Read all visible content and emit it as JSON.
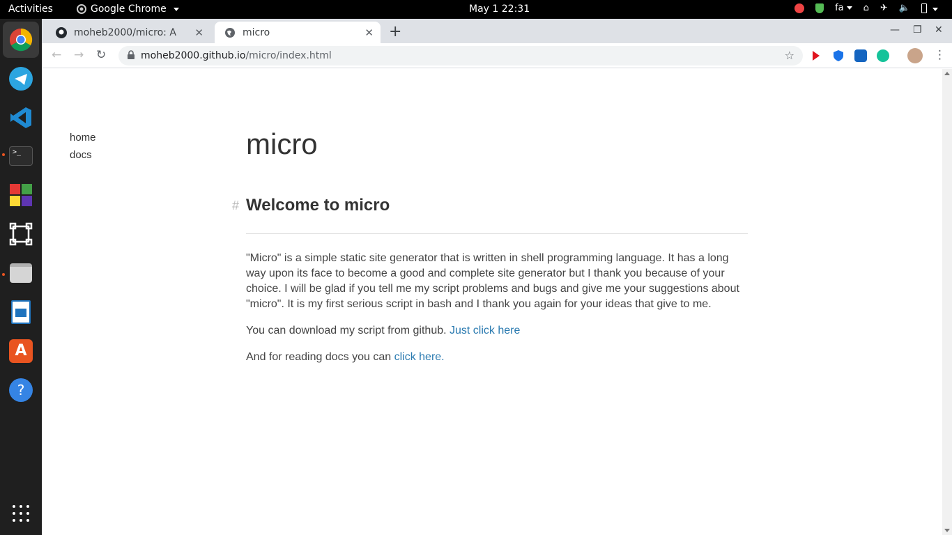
{
  "topbar": {
    "activities": "Activities",
    "app_name": "Google Chrome",
    "clock": "May 1  22:31",
    "keyboard_layout": "fa"
  },
  "dock": {
    "items": [
      "chrome-icon",
      "telegram-icon",
      "vscode-icon",
      "terminal-icon",
      "puzzle-app-icon",
      "vector-app-icon",
      "files-icon",
      "writer-icon",
      "software-center-icon",
      "help-icon"
    ]
  },
  "browser": {
    "tabs": [
      {
        "title": "moheb2000/micro: A stati",
        "icon": "github-icon"
      },
      {
        "title": "micro",
        "icon": "globe-icon"
      }
    ],
    "url_host": "moheb2000.github.io",
    "url_path": "/micro/index.html"
  },
  "page": {
    "nav": [
      "home",
      "docs"
    ],
    "title": "micro",
    "heading": "Welcome to micro",
    "heading_anchor": "#",
    "paragraph1": "\"Micro\" is a simple static site generator that is written in shell programming language. It has a long way upon its face to become a good and complete site generator but I thank you because of your choice. I will be glad if you tell me my script problems and bugs and give me your suggestions about \"micro\". It is my first serious script in bash and I thank you again for your ideas that give to me.",
    "paragraph2_text": "You can download my script from github.",
    "paragraph2_link": "Just click here",
    "paragraph3_text": "And for reading docs you can",
    "paragraph3_link": "click here",
    "paragraph3_end": "."
  },
  "colors": {
    "link": "#2a7ab0",
    "dock_bg": "#1f1f1f",
    "tabstrip_bg": "#dee1e6"
  }
}
